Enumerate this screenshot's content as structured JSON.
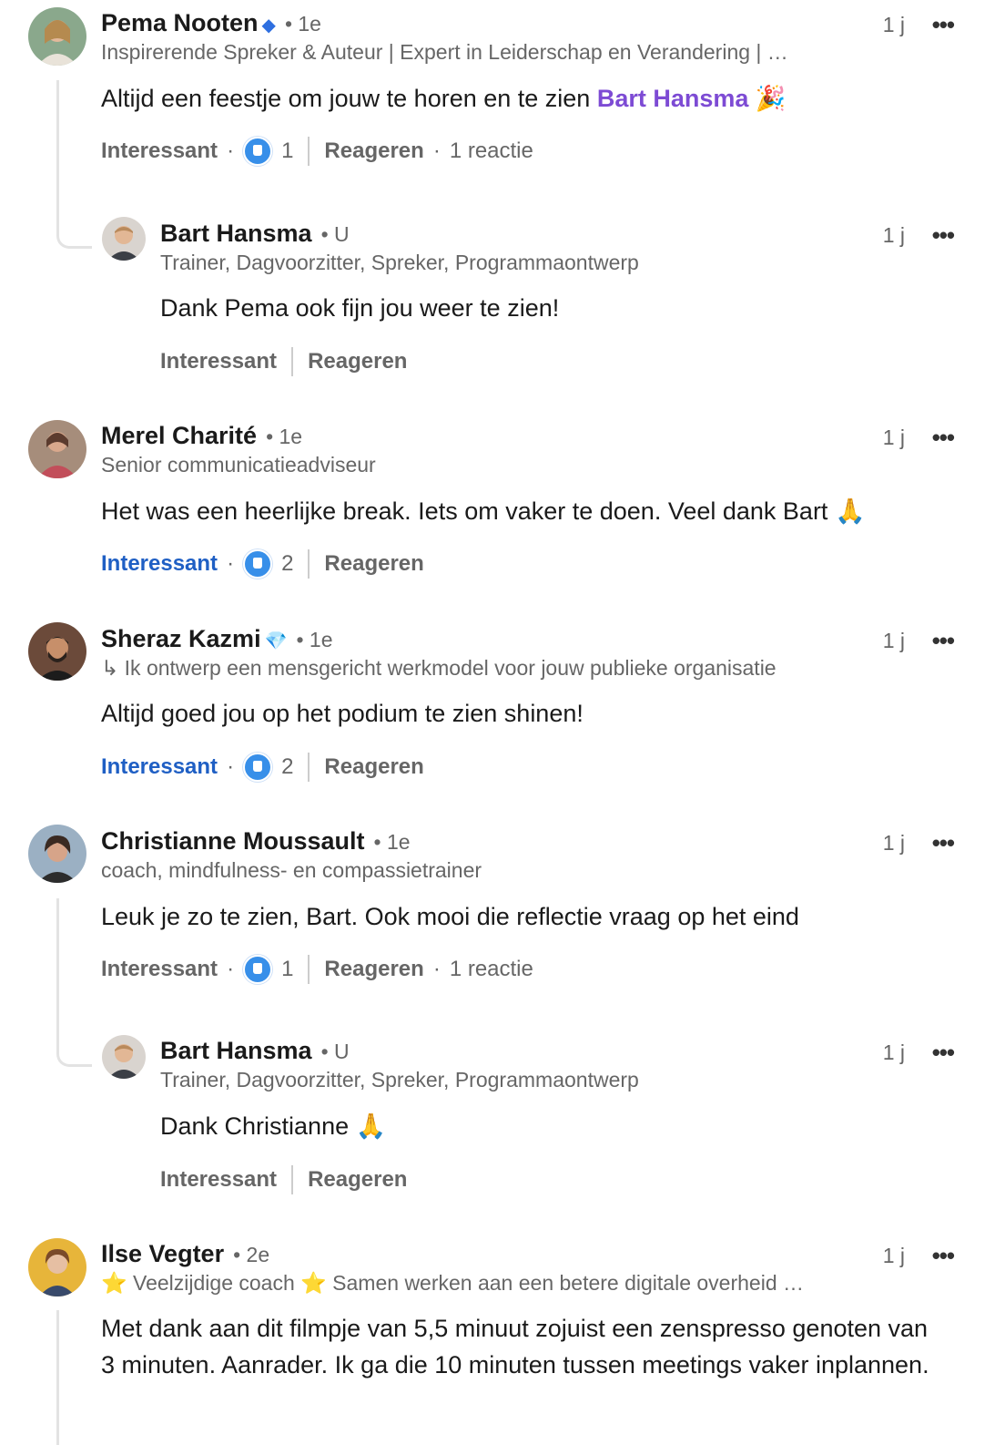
{
  "comments": [
    {
      "name": "Pema Nooten",
      "badge": "◆",
      "degree": "• 1e",
      "headline": "Inspirerende Spreker & Auteur | Expert in Leiderschap en Verandering | …",
      "time": "1 j",
      "text_before": "Altijd een feestje om jouw te horen en te zien ",
      "mention": "Bart Hansma",
      "text_emoji": "🎉",
      "action_label": "Interessant",
      "reaction_count": "1",
      "reply_label": "Reageren",
      "reply_count": "1 reactie"
    },
    {
      "name": "Bart Hansma",
      "degree": "• U",
      "headline": "Trainer, Dagvoorzitter, Spreker, Programmaontwerp",
      "time": "1 j",
      "text": "Dank Pema ook fijn jou weer te zien!",
      "action_label": "Interessant",
      "reply_label": "Reageren"
    },
    {
      "name": "Merel Charité",
      "degree": "• 1e",
      "headline": "Senior communicatieadviseur",
      "time": "1 j",
      "text": "Het was een heerlijke break. Iets om vaker te doen. Veel dank Bart 🙏",
      "action_label": "Interessant",
      "reaction_count": "2",
      "reply_label": "Reageren"
    },
    {
      "name": "Sheraz Kazmi",
      "badge": "💎",
      "degree": "• 1e",
      "headline": "↳ Ik ontwerp een mensgericht werkmodel voor jouw publieke organisatie",
      "time": "1 j",
      "text": "Altijd goed jou op het podium te zien shinen!",
      "action_label": "Interessant",
      "reaction_count": "2",
      "reply_label": "Reageren"
    },
    {
      "name": "Christianne Moussault",
      "degree": "• 1e",
      "headline": "coach, mindfulness- en compassietrainer",
      "time": "1 j",
      "text": "Leuk je zo te zien, Bart. Ook mooi die reflectie vraag op het eind",
      "action_label": "Interessant",
      "reaction_count": "1",
      "reply_label": "Reageren",
      "reply_count": "1 reactie"
    },
    {
      "name": "Bart Hansma",
      "degree": "• U",
      "headline": "Trainer, Dagvoorzitter, Spreker, Programmaontwerp",
      "time": "1 j",
      "text": "Dank Christianne 🙏",
      "action_label": "Interessant",
      "reply_label": "Reageren"
    },
    {
      "name": "Ilse Vegter",
      "degree": "• 2e",
      "headline": "⭐ Veelzijdige coach ⭐ Samen werken aan een betere digitale overheid …",
      "time": "1 j",
      "text": "Met dank aan dit filmpje van 5,5 minuut zojuist een zenspresso genoten van 3 minuten. Aanrader. Ik ga die 10 minuten tussen meetings vaker inplannen."
    }
  ],
  "more_icon": "•••",
  "colors": {
    "mention": "#7d4bd4",
    "active_reaction": "#1f5fc4",
    "like_icon": "#378fe9"
  }
}
